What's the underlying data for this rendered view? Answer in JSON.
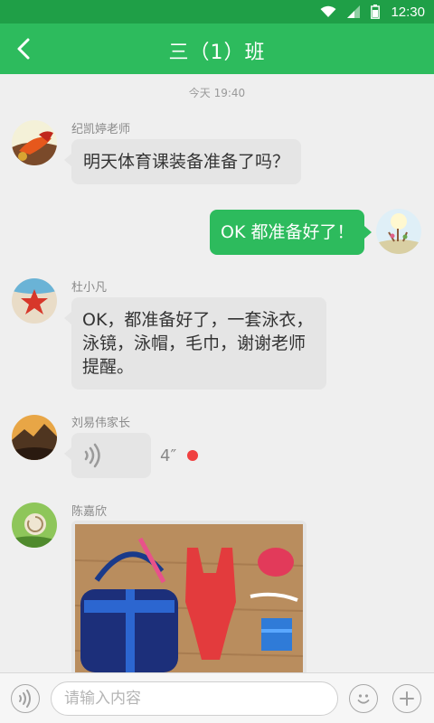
{
  "status": {
    "time": "12:30"
  },
  "header": {
    "title": "三（1）班"
  },
  "chat": {
    "timestamp": "今天 19:40",
    "messages": [
      {
        "sender": "纪凯婷老师",
        "text": "明天体育课装备准备了吗？"
      },
      {
        "sender": "me",
        "text": "OK 都准备好了！"
      },
      {
        "sender": "杜小凡",
        "lines": [
          "OK，都准备好了，一套泳衣，",
          "泳镜，泳帽，毛巾，谢谢老师",
          "提醒。"
        ]
      },
      {
        "sender": "刘易伟家长",
        "voice_duration": "4″",
        "unread": true
      },
      {
        "sender": "陈嘉欣",
        "type": "image",
        "image_desc": "swimming gear"
      }
    ]
  },
  "input": {
    "placeholder": "请输入内容"
  },
  "colors": {
    "primary": "#2dbb5d",
    "status_bar": "#1f9f47",
    "unread": "#f04040"
  }
}
